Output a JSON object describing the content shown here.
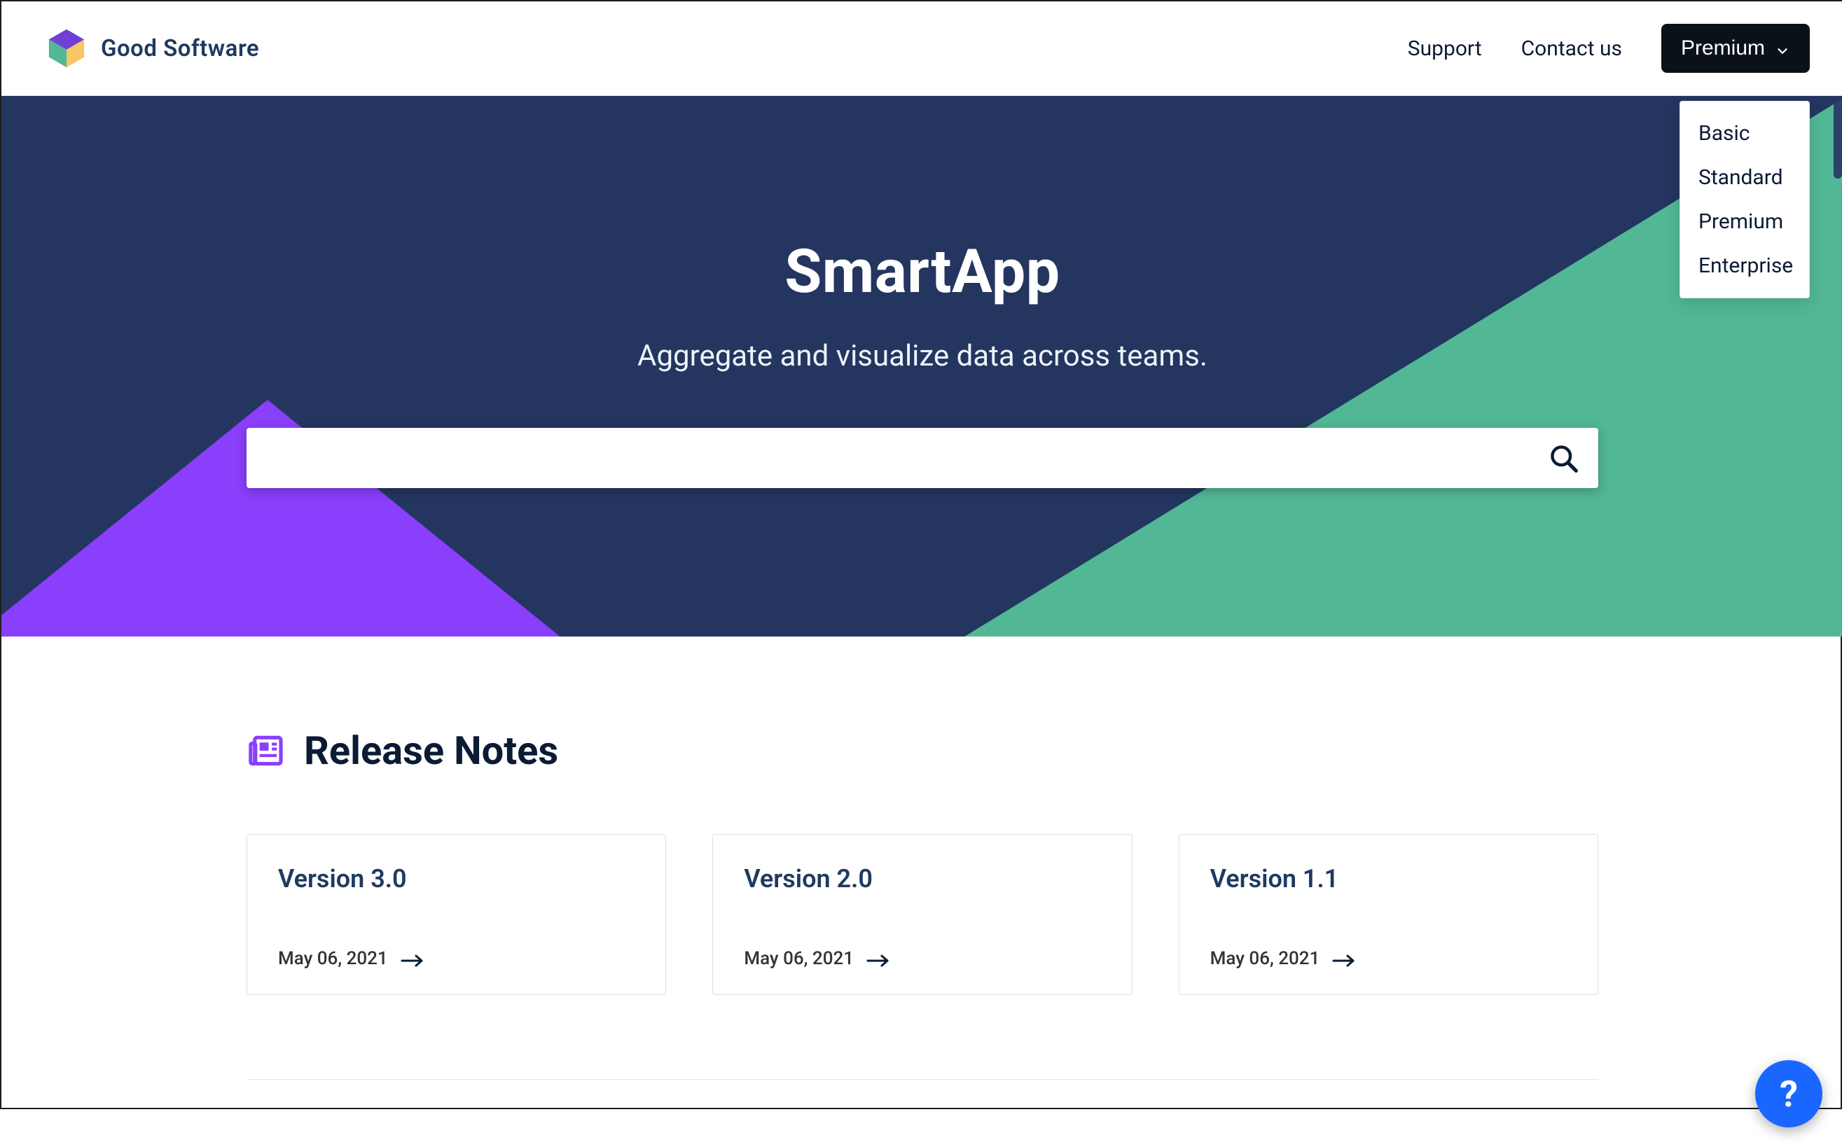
{
  "brand": {
    "name": "Good Software"
  },
  "nav": {
    "support": "Support",
    "contact": "Contact us",
    "premium_button": "Premium",
    "dropdown": [
      "Basic",
      "Standard",
      "Premium",
      "Enterprise"
    ]
  },
  "hero": {
    "title": "SmartApp",
    "tagline": "Aggregate and visualize data across teams.",
    "search_placeholder": ""
  },
  "release_notes": {
    "heading": "Release Notes",
    "cards": [
      {
        "title": "Version 3.0",
        "date": "May 06, 2021"
      },
      {
        "title": "Version 2.0",
        "date": "May 06, 2021"
      },
      {
        "title": "Version 1.1",
        "date": "May 06, 2021"
      }
    ]
  },
  "fab": {
    "label": "?"
  },
  "colors": {
    "navy": "#24365F",
    "teal": "#51B795",
    "purple": "#8A3FFC",
    "accent_purple": "#8A3FFC",
    "link_blue": "#1967FF"
  }
}
